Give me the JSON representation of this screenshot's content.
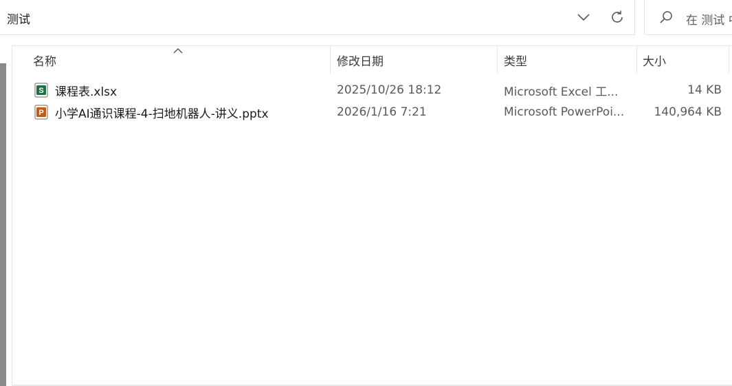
{
  "address_bar": {
    "path": "测试",
    "dropdown_icon": "chevron-down-icon",
    "refresh_icon": "refresh-icon"
  },
  "search": {
    "placeholder": "在 测试 中搜索",
    "icon": "search-icon"
  },
  "columns": {
    "name": "名称",
    "date_modified": "修改日期",
    "type": "类型",
    "size": "大小"
  },
  "files": [
    {
      "name": "课程表.xlsx",
      "date_modified": "2025/10/26 18:12",
      "type": "Microsoft Excel 工...",
      "size": "14 KB",
      "icon": "excel-file-icon",
      "icon_letter": "S",
      "icon_color": "#1e7145"
    },
    {
      "name": "小学AI通识课程-4-扫地机器人-讲义.pptx",
      "date_modified": "2026/1/16 7:21",
      "type": "Microsoft PowerPoi...",
      "size": "140,964 KB",
      "icon": "powerpoint-file-icon",
      "icon_letter": "P",
      "icon_color": "#c55a11"
    }
  ]
}
